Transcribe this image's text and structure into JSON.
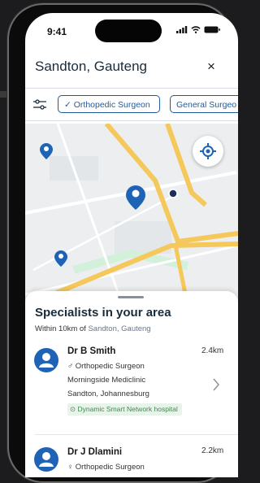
{
  "status_bar": {
    "time": "9:41"
  },
  "header": {
    "location": "Sandton, Gauteng",
    "close_glyph": "×"
  },
  "filters": {
    "chips": [
      {
        "label": "Orthopedic Surgeon",
        "selected": true
      },
      {
        "label": "General Surgeo"
      }
    ]
  },
  "map": {
    "pin_color": "#1e63b6",
    "road_color": "#f4c85a"
  },
  "sheet": {
    "title": "Specialists in your area",
    "subtitle_prefix": "Within 10km of",
    "subtitle_place": "Sandton, Gauteng",
    "doctors": [
      {
        "name": "Dr B Smith",
        "distance": "2.4km",
        "gender_glyph": "♂",
        "specialty": "Orthopedic Surgeon",
        "practice": "Morningside Mediclinic",
        "address": "Sandton, Johannesburg",
        "badge": "Dynamic Smart Network hospital"
      },
      {
        "name": "Dr J Dlamini",
        "distance": "2.2km",
        "gender_glyph": "♀",
        "specialty": "Orthopedic Surgeon"
      }
    ]
  },
  "colors": {
    "primary": "#1f5a9e",
    "badge_bg": "#e8f4ea",
    "badge_text": "#3c8a4e"
  }
}
